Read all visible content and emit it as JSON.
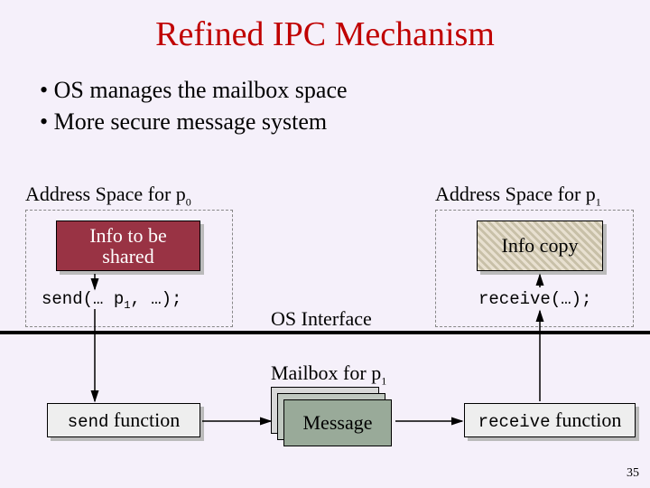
{
  "title": "Refined IPC Mechanism",
  "bullets": {
    "b1": "OS manages the mailbox space",
    "b2": "More secure message system"
  },
  "labels": {
    "as0_pre": "Address Space for p",
    "as0_sub": "0",
    "as1_pre": "Address Space for p",
    "as1_sub": "1",
    "info_shared_l1": "Info to be",
    "info_shared_l2": "shared",
    "info_copy": "Info copy",
    "send_call_pre": "send(… p",
    "send_call_sub": "1",
    "send_call_post": ", …);",
    "recv_call": "receive(…);",
    "os_interface": "OS Interface",
    "mailbox_pre": "Mailbox for p",
    "mailbox_sub": "1",
    "send_fn_code": "send",
    "send_fn_word": " function",
    "recv_fn_code": "receive",
    "recv_fn_word": " function",
    "message": "Message"
  },
  "slide_number": "35",
  "colors": {
    "title": "#c00000",
    "info_shared_bg": "#993344",
    "message_bg": "#99aa99"
  }
}
